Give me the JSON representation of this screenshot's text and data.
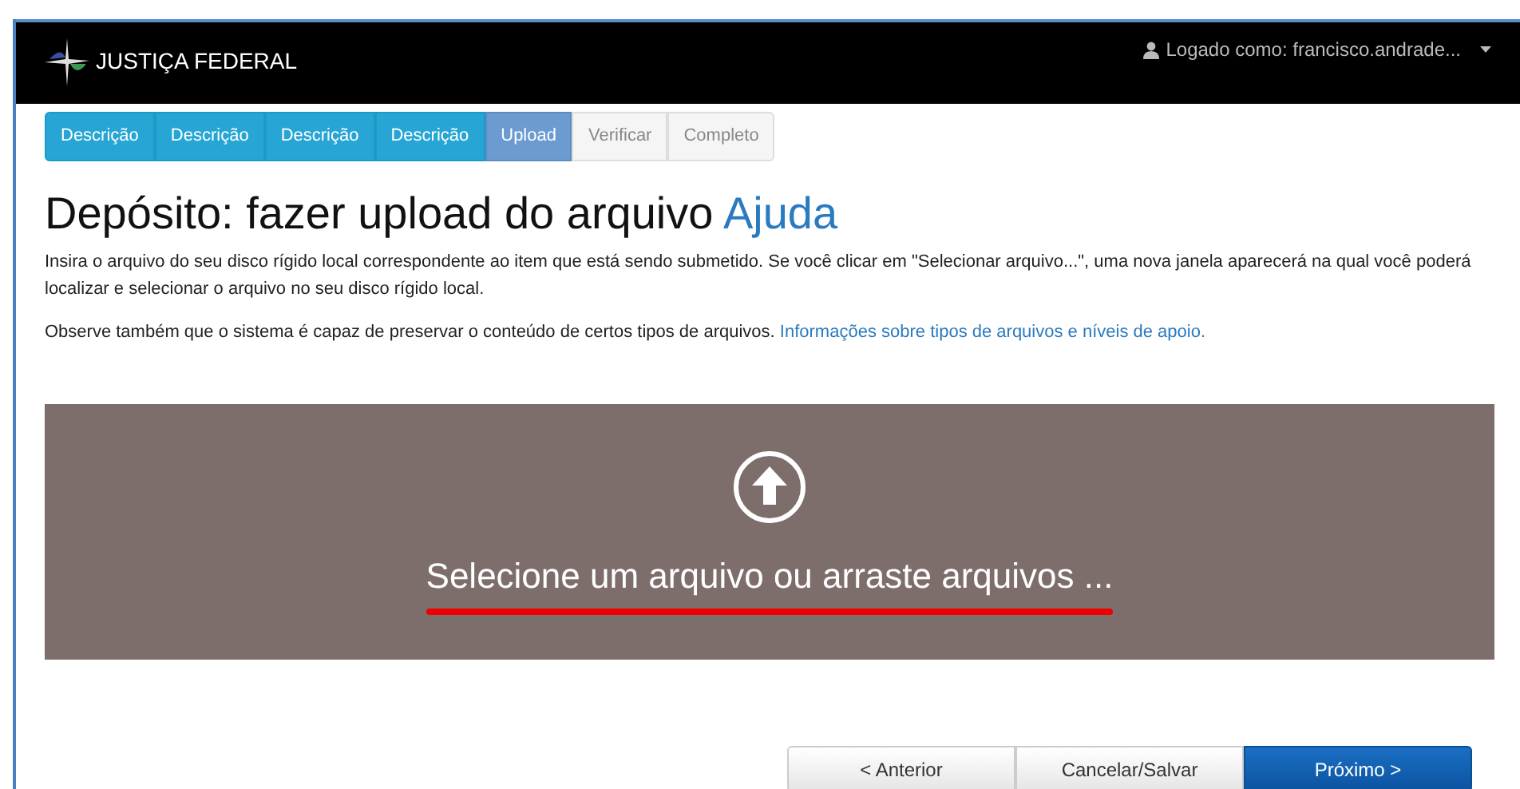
{
  "navbar": {
    "brand": "JUSTIÇA FEDERAL",
    "user": "Logado como: francisco.andrade..."
  },
  "steps": [
    {
      "label": "Descrição",
      "selected": false,
      "disabled": false
    },
    {
      "label": "Descrição",
      "selected": false,
      "disabled": false
    },
    {
      "label": "Descrição",
      "selected": false,
      "disabled": false
    },
    {
      "label": "Descrição",
      "selected": false,
      "disabled": false
    },
    {
      "label": "Upload",
      "selected": true,
      "disabled": false
    },
    {
      "label": "Verificar",
      "selected": false,
      "disabled": true
    },
    {
      "label": "Completo",
      "selected": false,
      "disabled": true
    }
  ],
  "heading": {
    "title": "Depósito: fazer upload do arquivo",
    "help_link": "Ajuda"
  },
  "paragraphs": [
    {
      "text": "Insira o arquivo do seu disco rígido local correspondente ao item que está sendo submetido. Se você clicar em \"Selecionar arquivo...\", uma nova janela aparecerá na qual você poderá localizar e selecionar o arquivo no seu disco rígido local."
    },
    {
      "text": "Observe também que o sistema é capaz de preservar o conteúdo de certos tipos de arquivos.",
      "link": "Informações sobre tipos de arquivos e níveis de apoio."
    }
  ],
  "dropzone": {
    "label": "Selecione um arquivo ou arraste arquivos ...",
    "underlined": true
  },
  "buttons": [
    {
      "label": "< Anterior",
      "kind": "default"
    },
    {
      "label": "Cancelar/Salvar",
      "kind": "default"
    },
    {
      "label": "Próximo >",
      "kind": "primary"
    }
  ]
}
